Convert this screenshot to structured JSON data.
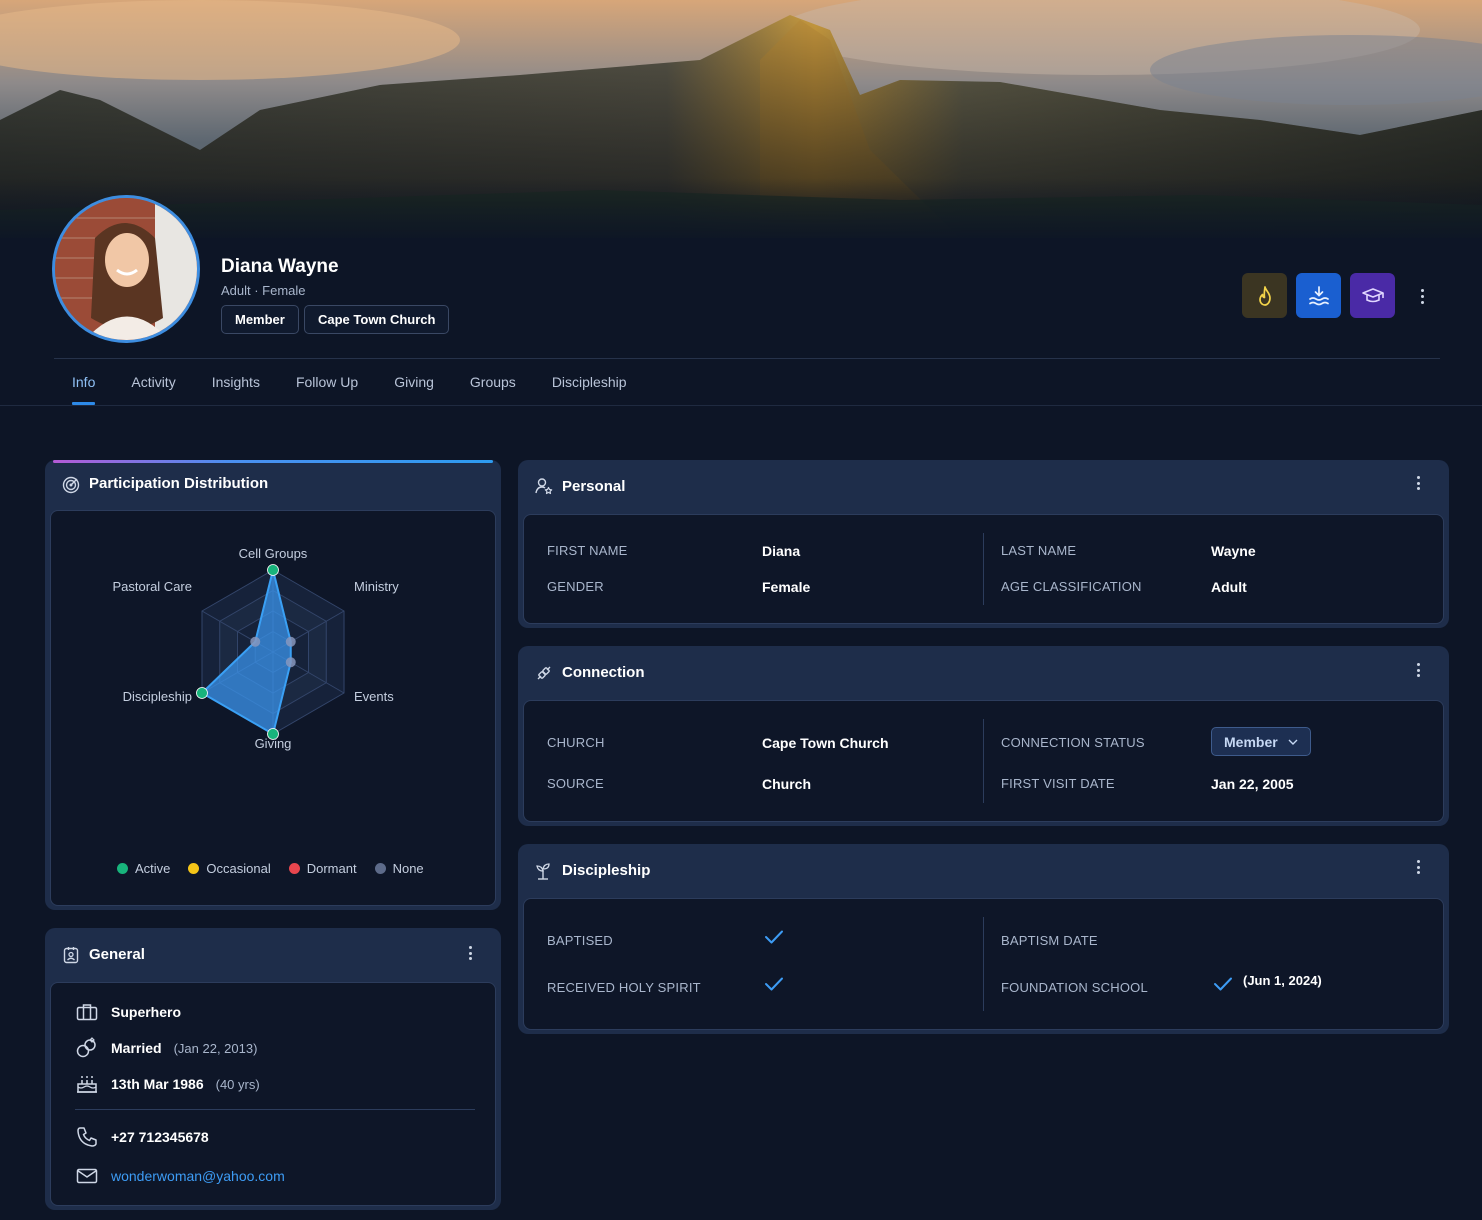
{
  "profile": {
    "name": "Diana Wayne",
    "subtitle": "Adult · Female",
    "chips": [
      "Member",
      "Cape Town Church"
    ]
  },
  "quick_actions": [
    {
      "name": "fire-icon",
      "color": "#f3d44a"
    },
    {
      "name": "baptism-icon",
      "color": "#e8f1ff"
    },
    {
      "name": "graduation-cap-icon",
      "color": "#e0d6ff"
    }
  ],
  "tabs": [
    "Info",
    "Activity",
    "Insights",
    "Follow Up",
    "Giving",
    "Groups",
    "Discipleship"
  ],
  "active_tab": "Info",
  "participation": {
    "title": "Participation Distribution",
    "axes": [
      "Cell Groups",
      "Ministry",
      "Events",
      "Giving",
      "Discipleship",
      "Pastoral Care"
    ],
    "legend": [
      {
        "label": "Active",
        "color": "#18b47c"
      },
      {
        "label": "Occasional",
        "color": "#f5c518"
      },
      {
        "label": "Dormant",
        "color": "#e8464e"
      },
      {
        "label": "None",
        "color": "#5d6b8a"
      }
    ]
  },
  "chart_data": {
    "type": "radar",
    "categories": [
      "Cell Groups",
      "Ministry",
      "Events",
      "Giving",
      "Discipleship",
      "Pastoral Care"
    ],
    "values": [
      1,
      0.25,
      0.25,
      1,
      1,
      0.25
    ],
    "rlim": [
      0,
      1
    ],
    "status": [
      "Active",
      "None",
      "None",
      "Active",
      "Active",
      "None"
    ],
    "rings": 4,
    "legend_position": "bottom"
  },
  "general": {
    "title": "General",
    "occupation": "Superhero",
    "marital": "Married",
    "marital_date": "(Jan 22, 2013)",
    "birthday": "13th Mar 1986",
    "age": "(40 yrs)",
    "phone": "+27 712345678",
    "email": "wonderwoman@yahoo.com"
  },
  "personal": {
    "title": "Personal",
    "first_name_label": "FIRST NAME",
    "first_name": "Diana",
    "gender_label": "GENDER",
    "gender": "Female",
    "last_name_label": "LAST NAME",
    "last_name": "Wayne",
    "age_label": "AGE CLASSIFICATION",
    "age": "Adult"
  },
  "connection": {
    "title": "Connection",
    "church_label": "CHURCH",
    "church": "Cape Town Church",
    "source_label": "SOURCE",
    "source": "Church",
    "status_label": "CONNECTION STATUS",
    "status": "Member",
    "first_visit_label": "FIRST VISIT DATE",
    "first_visit": "Jan 22, 2005"
  },
  "discipleship": {
    "title": "Discipleship",
    "baptised_label": "BAPTISED",
    "holy_spirit_label": "RECEIVED HOLY SPIRIT",
    "baptism_date_label": "BAPTISM DATE",
    "foundation_label": "FOUNDATION SCHOOL",
    "foundation_date": "(Jun 1, 2024)",
    "baptised": true,
    "holy_spirit": true,
    "foundation": true
  }
}
